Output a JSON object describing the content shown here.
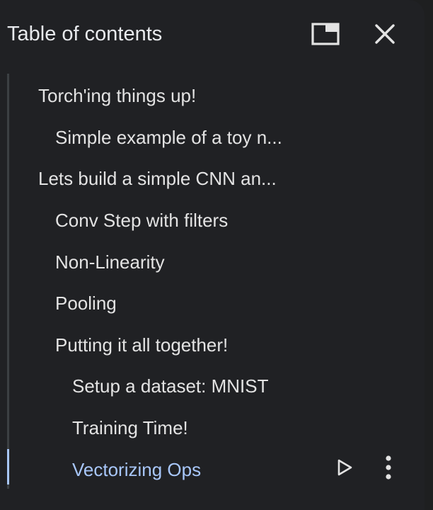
{
  "header": {
    "title": "Table of contents",
    "float_icon": "floating-window-icon",
    "close_icon": "close-icon"
  },
  "toc": {
    "items": [
      {
        "label": "Torch'ing things up!",
        "level": 1
      },
      {
        "label": "Simple example of a toy n...",
        "level": 2
      },
      {
        "label": "Lets build a simple CNN an...",
        "level": 1
      },
      {
        "label": "Conv Step with filters",
        "level": 2
      },
      {
        "label": "Non-Linearity",
        "level": 2
      },
      {
        "label": "Pooling",
        "level": 2
      },
      {
        "label": "Putting it all together!",
        "level": 2
      },
      {
        "label": "Setup a dataset: MNIST",
        "level": 3
      },
      {
        "label": "Training Time!",
        "level": 3
      },
      {
        "label": "Vectorizing Ops",
        "level": 3,
        "active": true
      }
    ],
    "active_actions": {
      "run_icon": "play-icon",
      "more_icon": "more-vert-icon"
    }
  },
  "colors": {
    "background": "#202124",
    "text": "#e3e3e3",
    "active": "#a8c7fa",
    "track": "#3c4043"
  }
}
